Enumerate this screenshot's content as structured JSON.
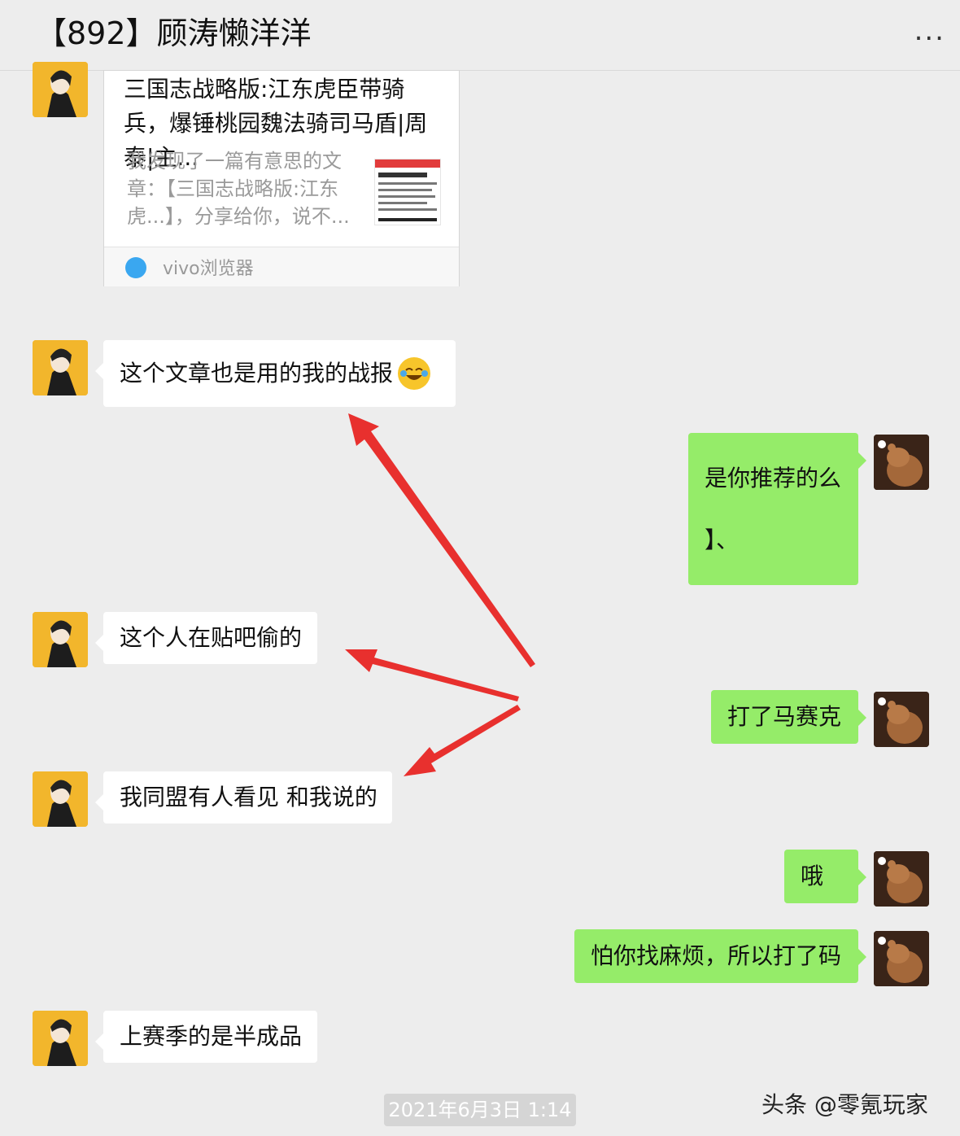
{
  "header": {
    "title": "【892】顾涛懒洋洋",
    "more": "..."
  },
  "card": {
    "title": "三国志战略版:江东虎臣带骑兵，爆锤桃园魏法骑司马盾|周泰|主...",
    "description": "我发现了一篇有意思的文章：【三国志战略版:江东虎...】，分享给你，说不...",
    "app": "vivo浏览器"
  },
  "messages": {
    "m1": "这个文章也是用的我的战报",
    "m2_line1": "是你推荐的么",
    "m2_line2": "】、",
    "m3": "这个人在贴吧偷的",
    "m4": "打了马赛克",
    "m5": "我同盟有人看见 和我说的",
    "m6": "哦",
    "m7": "怕你找麻烦，所以打了码",
    "m8": "上赛季的是半成品"
  },
  "timestamp": "2021年6月3日 1:14",
  "watermark": "头条 @零氪玩家",
  "colors": {
    "sent_bubble": "#95ec69",
    "received_bubble": "#ffffff",
    "arrow": "#e8302e"
  }
}
